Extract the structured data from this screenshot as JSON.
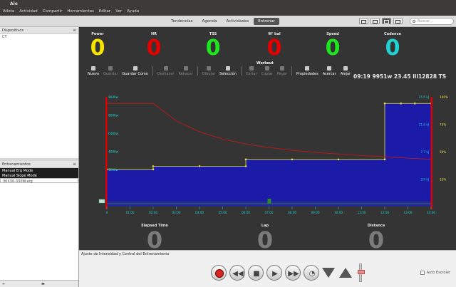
{
  "window": {
    "title": "Ale"
  },
  "menu": [
    "Atleta",
    "Actividad",
    "Compartir",
    "Herramientas",
    "Editar",
    "Ver",
    "Ayuda"
  ],
  "tabs": [
    {
      "label": "Tendencias",
      "active": false
    },
    {
      "label": "Agenda",
      "active": false
    },
    {
      "label": "Actividades",
      "active": false
    },
    {
      "label": "Entrenar",
      "active": true
    }
  ],
  "search": {
    "placeholder": "Buscar..."
  },
  "sidebar": {
    "devices_title": "Dispositivos",
    "devices_item": "CT",
    "workouts_title": "Entrenamientos",
    "workouts": [
      {
        "label": "Manual Erg Mode",
        "style": "dark"
      },
      {
        "label": "Manual Slope Mode",
        "style": "dark"
      },
      {
        "label": "30X30-330W.erg",
        "style": "light"
      }
    ],
    "bottom_plus": "+",
    "bottom_folder": "▬"
  },
  "metrics": [
    {
      "label": "Power",
      "value": "0",
      "color": "#f4e400"
    },
    {
      "label": "HR",
      "value": "0",
      "color": "#e60000"
    },
    {
      "label": "TSS",
      "value": "0",
      "color": "#1ee61e"
    },
    {
      "label": "W' bal",
      "value": "0",
      "color": "#e60000"
    },
    {
      "label": "Speed",
      "value": "0",
      "color": "#1ee61e"
    },
    {
      "label": "Cadence",
      "value": "0",
      "color": "#21d0d0"
    }
  ],
  "workout": {
    "title": "Workout",
    "readout": "09:19     9951w 23.45 lll12828 TS",
    "toolbar": [
      {
        "label": "Nuevo",
        "icon": "new-icon",
        "enabled": true
      },
      {
        "label": "Guardar",
        "icon": "save-icon",
        "enabled": false
      },
      {
        "label": "Guardar Como",
        "icon": "save-as-icon",
        "enabled": true
      },
      {
        "label": "Deshacer",
        "icon": "undo-icon",
        "enabled": false
      },
      {
        "label": "Rehacer",
        "icon": "redo-icon",
        "enabled": false
      },
      {
        "label": "Dibujar",
        "icon": "draw-icon",
        "enabled": false
      },
      {
        "label": "Selección",
        "icon": "select-icon",
        "enabled": true
      },
      {
        "label": "Cortar",
        "icon": "cut-icon",
        "enabled": false
      },
      {
        "label": "Copiar",
        "icon": "copy-icon",
        "enabled": false
      },
      {
        "label": "Pegar",
        "icon": "paste-icon",
        "enabled": false
      },
      {
        "label": "Propiedades",
        "icon": "properties-icon",
        "enabled": true
      },
      {
        "label": "Acercar",
        "icon": "zoom-in-icon",
        "enabled": true
      },
      {
        "label": "Alejar",
        "icon": "zoom-out-icon",
        "enabled": true
      }
    ]
  },
  "bottom_metrics": [
    {
      "label": "Elapsed Time",
      "value": "0"
    },
    {
      "label": "Lap",
      "value": "0"
    },
    {
      "label": "Distance",
      "value": "0"
    }
  ],
  "control_panel": {
    "label": "Ajuste de Intensidad y Control del Entrenamiento",
    "auto_scroll": "Auto Escroler"
  },
  "chart_data": {
    "type": "area",
    "x_ticks": [
      "0",
      "01:00",
      "02:00",
      "03:00",
      "04:00",
      "05:00",
      "06:00",
      "07:00",
      "08:00",
      "09:00",
      "10:00",
      "11:00",
      "12:00",
      "13:00",
      "14:00"
    ],
    "y_left_ticks": [
      "9680w",
      "8080w",
      "6480w",
      "4880w",
      "3280w"
    ],
    "y_right_kj_ticks": [
      "15.5 kJ",
      "11.6 kJ",
      "7.7 kJ",
      "3.9 kJ"
    ],
    "y_right_pct_ticks": [
      "100%",
      "75%",
      "50%",
      "25%"
    ],
    "xlim": [
      0,
      14
    ],
    "ylim": [
      0,
      9680
    ],
    "power_steps": [
      {
        "x0": 0,
        "x1": 2,
        "y": 3280
      },
      {
        "x0": 2,
        "x1": 6,
        "y": 3560
      },
      {
        "x0": 6,
        "x1": 12,
        "y": 4160
      },
      {
        "x0": 12,
        "x1": 14,
        "y": 9100
      }
    ],
    "power_points": [
      [
        0,
        3280
      ],
      [
        2,
        3280
      ],
      [
        2,
        3560
      ],
      [
        4,
        3560
      ],
      [
        6,
        3560
      ],
      [
        6,
        4160
      ],
      [
        8,
        4160
      ],
      [
        10,
        4160
      ],
      [
        12,
        4160
      ],
      [
        12,
        9100
      ],
      [
        12.7,
        9100
      ],
      [
        13.3,
        9100
      ],
      [
        14,
        9100
      ]
    ],
    "wbal_curve": [
      [
        0,
        9100
      ],
      [
        2,
        9100
      ],
      [
        3,
        7560
      ],
      [
        4,
        6590
      ],
      [
        5,
        5960
      ],
      [
        6,
        5510
      ],
      [
        7,
        5210
      ],
      [
        8,
        4960
      ],
      [
        9,
        4780
      ],
      [
        10,
        4630
      ],
      [
        11,
        4500
      ],
      [
        12,
        4400
      ],
      [
        13,
        4270
      ],
      [
        14,
        4170
      ]
    ],
    "colors": {
      "area": "#1b1ba8",
      "power_line": "#e8e24a",
      "wbal_line": "#c01818",
      "axis_marker": "#e00000",
      "tick_label": "#21d0d0",
      "right_tick": "#e8e24a"
    }
  }
}
